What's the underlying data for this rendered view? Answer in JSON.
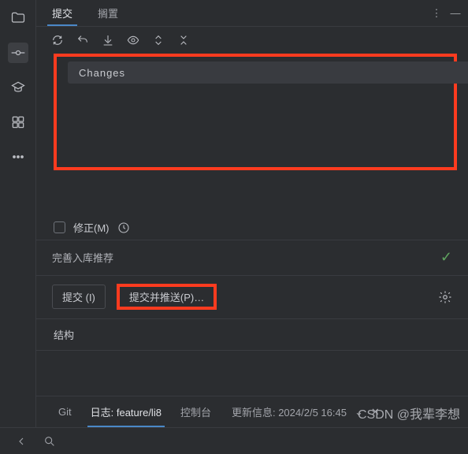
{
  "tabs": {
    "commit": "提交",
    "shelve": "搁置"
  },
  "changes_header": "Changes",
  "amend": {
    "label": "修正(M)"
  },
  "commit_message": "完善入库推荐",
  "buttons": {
    "commit": "提交 (I)",
    "commit_push": "提交并推送(P)…"
  },
  "structure_label": "结构",
  "bottom": {
    "git": "Git",
    "log": "日志: feature/li8",
    "console": "控制台",
    "update_info": "更新信息: 2024/2/5 16:45"
  },
  "watermark": "CSDN @我辈李想"
}
